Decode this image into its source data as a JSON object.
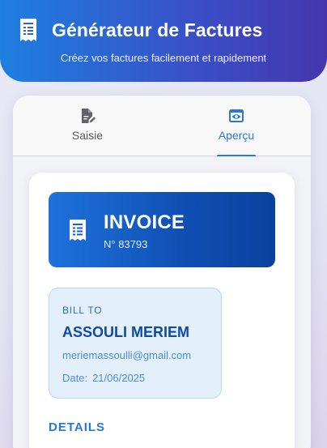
{
  "header": {
    "title": "Générateur de Factures",
    "subtitle": "Créez vos factures facilement et rapidement",
    "icon": "receipt-icon"
  },
  "tabs": [
    {
      "label": "Saisie",
      "icon": "edit-document-icon",
      "active": false
    },
    {
      "label": "Aperçu",
      "icon": "eye-icon",
      "active": true
    }
  ],
  "invoice": {
    "title": "INVOICE",
    "number": "N° 83793",
    "icon": "receipt-icon"
  },
  "bill_to": {
    "label": "BILL TO",
    "name": "ASSOULI MERIEM",
    "email": "meriemassoulli@gmail.com",
    "date_label": "Date:",
    "date_value": "21/06/2025"
  },
  "details": {
    "label": "DETAILS"
  },
  "colors": {
    "accent": "#2a78d4",
    "header_start": "#1e7fe0",
    "header_end": "#4536ae",
    "banner_dark": "#0b41a0"
  }
}
